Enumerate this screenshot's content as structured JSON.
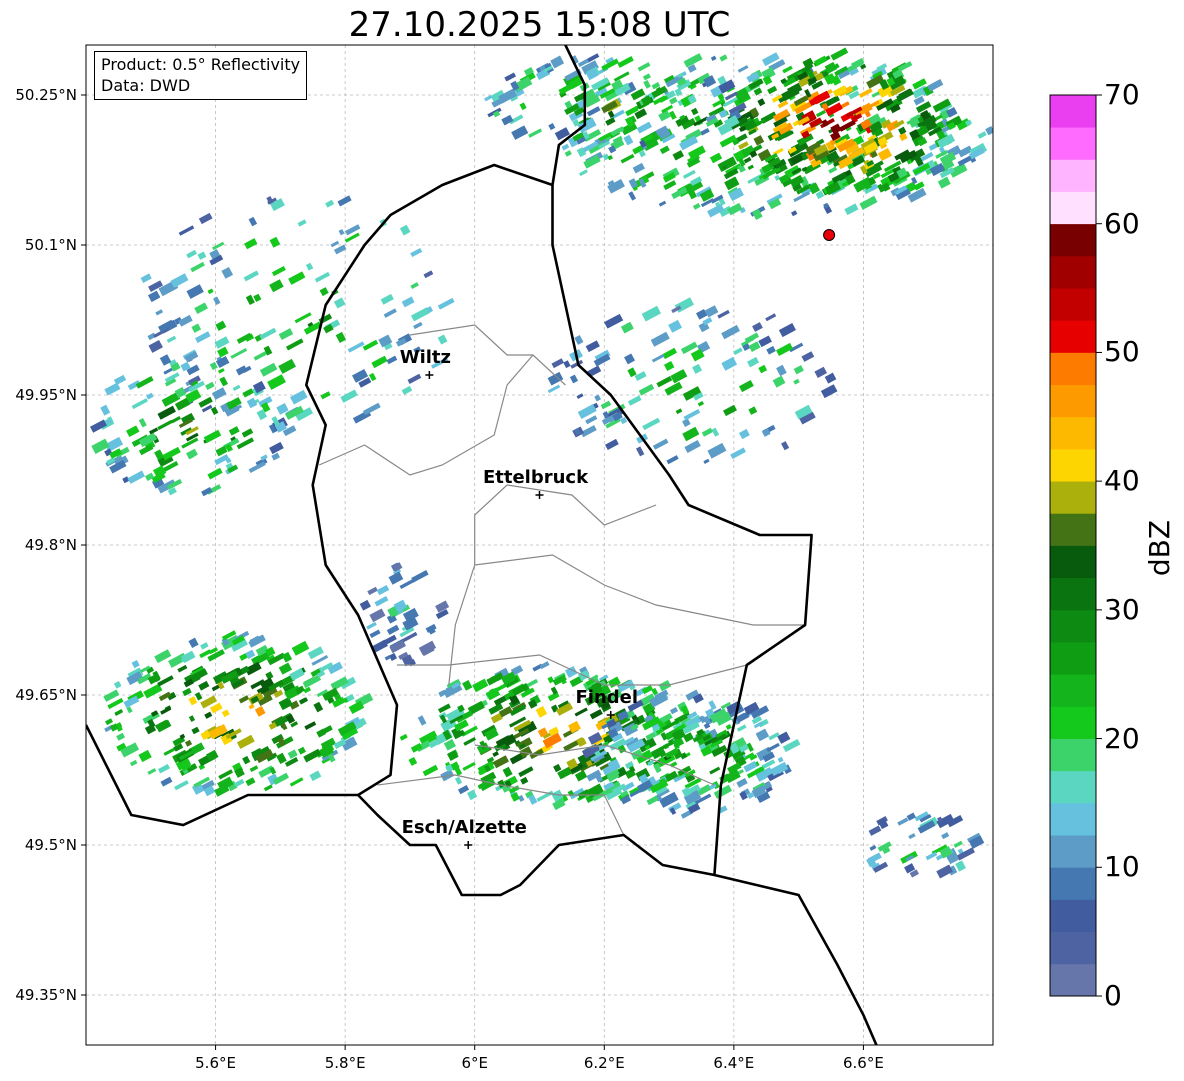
{
  "title": "27.10.2025 15:08 UTC",
  "info_box": {
    "product": "Product: 0.5° Reflectivity",
    "data_source": "Data: DWD"
  },
  "map": {
    "lon_range": [
      5.4,
      6.8
    ],
    "lat_range": [
      49.3,
      50.3
    ],
    "lat_ticks": [
      "50.25°N",
      "50.1°N",
      "49.95°N",
      "49.8°N",
      "49.65°N",
      "49.5°N",
      "49.35°N"
    ],
    "lon_ticks": [
      "5.6°E",
      "5.8°E",
      "6°E",
      "6.2°E",
      "6.4°E",
      "6.6°E"
    ],
    "cities": [
      {
        "name": "Wiltz",
        "lon": 5.93,
        "lat": 49.97
      },
      {
        "name": "Ettelbruck",
        "lon": 6.1,
        "lat": 49.85
      },
      {
        "name": "Findel",
        "lon": 6.21,
        "lat": 49.63
      },
      {
        "name": "Esch/Alzette",
        "lon": 5.99,
        "lat": 49.5
      }
    ],
    "radar_site": {
      "lon": 6.547,
      "lat": 50.11,
      "color": "#e8000b"
    },
    "border_color": "#000000",
    "canton_color": "#888888",
    "grid": true
  },
  "colorbar": {
    "label": "dBZ",
    "ticks": [
      "0",
      "10",
      "20",
      "30",
      "40",
      "50",
      "60",
      "70"
    ],
    "range": [
      0,
      70
    ],
    "colors": [
      "#6676aa",
      "#4e63a1",
      "#415da0",
      "#4577b1",
      "#5c9cc6",
      "#65c1dd",
      "#5bd7c1",
      "#3cd46a",
      "#14c81c",
      "#14b41c",
      "#0f9d14",
      "#0c8a12",
      "#0a7410",
      "#085a0c",
      "#437315",
      "#abb00d",
      "#fdd500",
      "#fdb800",
      "#fd9a00",
      "#fd7c00",
      "#e60000",
      "#c20000",
      "#a00000",
      "#780000",
      "#ffe0ff",
      "#ffb4ff",
      "#ff6bff",
      "#e93ff0"
    ]
  },
  "echo_clusters": [
    {
      "lon": 6.45,
      "lat": 50.21,
      "rlon": 0.34,
      "rlat": 0.08,
      "level": 14,
      "n": 260
    },
    {
      "lon": 6.55,
      "lat": 50.22,
      "rlon": 0.18,
      "rlat": 0.07,
      "level": 24,
      "n": 240
    },
    {
      "lon": 6.2,
      "lat": 50.24,
      "rlon": 0.2,
      "rlat": 0.05,
      "level": 12,
      "n": 120
    },
    {
      "lon": 5.72,
      "lat": 50.03,
      "rlon": 0.25,
      "rlat": 0.12,
      "level": 10,
      "n": 130
    },
    {
      "lon": 5.55,
      "lat": 49.92,
      "rlon": 0.16,
      "rlat": 0.07,
      "level": 13,
      "n": 110
    },
    {
      "lon": 6.33,
      "lat": 49.96,
      "rlon": 0.22,
      "rlat": 0.08,
      "level": 10,
      "n": 110
    },
    {
      "lon": 5.62,
      "lat": 49.63,
      "rlon": 0.2,
      "rlat": 0.08,
      "level": 18,
      "n": 230
    },
    {
      "lon": 5.88,
      "lat": 49.73,
      "rlon": 0.06,
      "rlat": 0.05,
      "level": 6,
      "n": 40
    },
    {
      "lon": 6.12,
      "lat": 49.61,
      "rlon": 0.24,
      "rlat": 0.07,
      "level": 18,
      "n": 280
    },
    {
      "lon": 6.32,
      "lat": 49.59,
      "rlon": 0.16,
      "rlat": 0.06,
      "level": 12,
      "n": 180
    },
    {
      "lon": 6.67,
      "lat": 49.5,
      "rlon": 0.1,
      "rlat": 0.03,
      "level": 8,
      "n": 40
    }
  ]
}
